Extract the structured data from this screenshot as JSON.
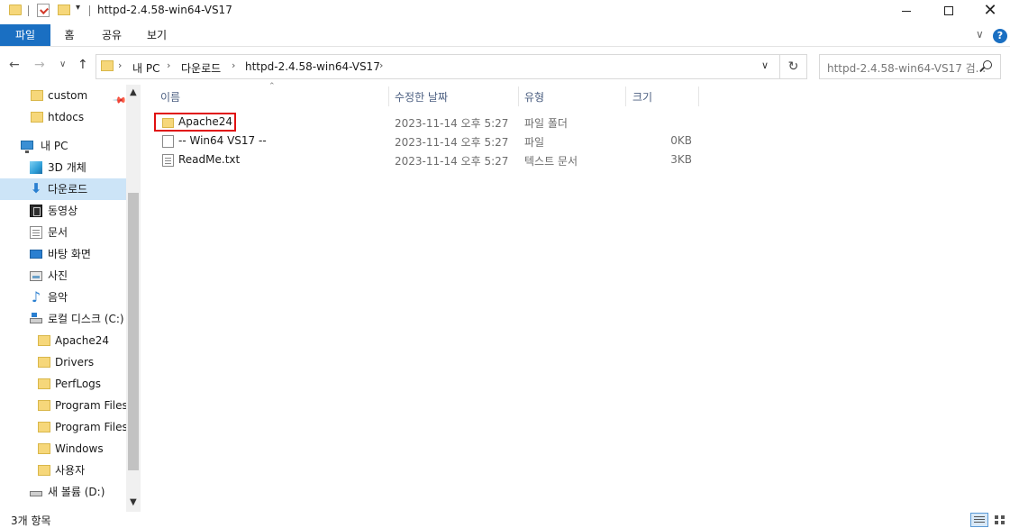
{
  "window": {
    "title": "httpd-2.4.58-win64-VS17",
    "minimize_glyph": "—",
    "close_glyph": "✕"
  },
  "ribbon": {
    "tabs": [
      {
        "label": "파일"
      },
      {
        "label": "홈"
      },
      {
        "label": "공유"
      },
      {
        "label": "보기"
      }
    ],
    "help_glyph": "?",
    "expand_glyph": "∨"
  },
  "address": {
    "crumbs": [
      "내 PC",
      "다운로드",
      "httpd-2.4.58-win64-VS17"
    ],
    "separator": "›",
    "search_placeholder": "httpd-2.4.58-win64-VS17 검..."
  },
  "nav_glyphs": {
    "back": "←",
    "forward": "→",
    "recent": "∨",
    "up": "↑",
    "refresh": "↻",
    "dropdown": "∨"
  },
  "nav_pane": {
    "items": [
      {
        "label": "custom",
        "icon": "folder-icon",
        "pinned": true
      },
      {
        "label": "htdocs",
        "icon": "folder-icon"
      },
      {
        "label": "내 PC",
        "icon": "pc-icon"
      },
      {
        "label": "3D 개체",
        "icon": "cube-icon"
      },
      {
        "label": "다운로드",
        "icon": "download-icon",
        "selected": true
      },
      {
        "label": "동영상",
        "icon": "video-icon"
      },
      {
        "label": "문서",
        "icon": "document-icon"
      },
      {
        "label": "바탕 화면",
        "icon": "desktop-icon"
      },
      {
        "label": "사진",
        "icon": "pictures-icon"
      },
      {
        "label": "음악",
        "icon": "music-icon"
      },
      {
        "label": "로컬 디스크 (C:)",
        "icon": "drive-icon"
      },
      {
        "label": "Apache24",
        "icon": "folder-icon"
      },
      {
        "label": "Drivers",
        "icon": "folder-icon"
      },
      {
        "label": "PerfLogs",
        "icon": "folder-icon"
      },
      {
        "label": "Program Files",
        "icon": "folder-icon"
      },
      {
        "label": "Program Files",
        "icon": "folder-icon"
      },
      {
        "label": "Windows",
        "icon": "folder-icon"
      },
      {
        "label": "사용자",
        "icon": "folder-icon"
      },
      {
        "label": "새 볼륨 (D:)",
        "icon": "drive-icon"
      }
    ]
  },
  "file_list": {
    "columns": {
      "name": "이름",
      "modified": "수정한 날짜",
      "type": "유형",
      "size": "크기"
    },
    "rows": [
      {
        "name": "Apache24",
        "modified": "2023-11-14 오후 5:27",
        "type": "파일 폴더",
        "size": "",
        "icon": "folder-icon",
        "highlighted": true
      },
      {
        "name": "-- Win64 VS17  --",
        "modified": "2023-11-14 오후 5:27",
        "type": "파일",
        "size": "0KB",
        "icon": "file-icon"
      },
      {
        "name": "ReadMe.txt",
        "modified": "2023-11-14 오후 5:27",
        "type": "텍스트 문서",
        "size": "3KB",
        "icon": "text-file-icon"
      }
    ]
  },
  "status": {
    "item_count": "3개 항목"
  },
  "colors": {
    "accent": "#1a6fc2",
    "selection": "#cce4f7",
    "highlight_border": "#e01010"
  }
}
